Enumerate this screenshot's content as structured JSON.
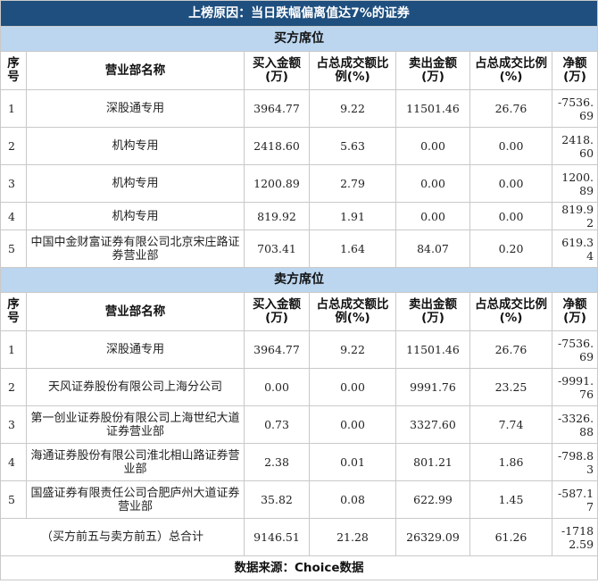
{
  "title": "上榜原因：当日跌幅偏离值达7%的证券",
  "headers": {
    "idx": "序号",
    "name": "营业部名称",
    "buy": "买入金额(万)",
    "buy_ratio": "占总成交额比例(%)",
    "sell": "卖出金额(万)",
    "sell_ratio": "占总成交比例(%)",
    "net": "净额(万)"
  },
  "buy_section": {
    "label": "买方席位",
    "rows": [
      {
        "idx": "1",
        "name": "深股通专用",
        "buy": "3964.77",
        "buy_ratio": "9.22",
        "sell": "11501.46",
        "sell_ratio": "26.76",
        "net": "-7536.69"
      },
      {
        "idx": "2",
        "name": "机构专用",
        "buy": "2418.60",
        "buy_ratio": "5.63",
        "sell": "0.00",
        "sell_ratio": "0.00",
        "net": "2418.60"
      },
      {
        "idx": "3",
        "name": "机构专用",
        "buy": "1200.89",
        "buy_ratio": "2.79",
        "sell": "0.00",
        "sell_ratio": "0.00",
        "net": "1200.89"
      },
      {
        "idx": "4",
        "name": "机构专用",
        "buy": "819.92",
        "buy_ratio": "1.91",
        "sell": "0.00",
        "sell_ratio": "0.00",
        "net": "819.92"
      },
      {
        "idx": "5",
        "name": "中国中金财富证券有限公司北京宋庄路证券营业部",
        "buy": "703.41",
        "buy_ratio": "1.64",
        "sell": "84.07",
        "sell_ratio": "0.20",
        "net": "619.34"
      }
    ]
  },
  "sell_section": {
    "label": "卖方席位",
    "rows": [
      {
        "idx": "1",
        "name": "深股通专用",
        "buy": "3964.77",
        "buy_ratio": "9.22",
        "sell": "11501.46",
        "sell_ratio": "26.76",
        "net": "-7536.69"
      },
      {
        "idx": "2",
        "name": "天风证券股份有限公司上海分公司",
        "buy": "0.00",
        "buy_ratio": "0.00",
        "sell": "9991.76",
        "sell_ratio": "23.25",
        "net": "-9991.76"
      },
      {
        "idx": "3",
        "name": "第一创业证券股份有限公司上海世纪大道证券营业部",
        "buy": "0.73",
        "buy_ratio": "0.00",
        "sell": "3327.60",
        "sell_ratio": "7.74",
        "net": "-3326.88"
      },
      {
        "idx": "4",
        "name": "海通证券股份有限公司淮北相山路证券营业部",
        "buy": "2.38",
        "buy_ratio": "0.01",
        "sell": "801.21",
        "sell_ratio": "1.86",
        "net": "-798.83"
      },
      {
        "idx": "5",
        "name": "国盛证券有限责任公司合肥庐州大道证券营业部",
        "buy": "35.82",
        "buy_ratio": "0.08",
        "sell": "622.99",
        "sell_ratio": "1.45",
        "net": "-587.17"
      }
    ]
  },
  "total": {
    "label": "（买方前五与卖方前五）总合计",
    "buy": "9146.51",
    "buy_ratio": "21.28",
    "sell": "26329.09",
    "sell_ratio": "61.26",
    "net": "-17182.59"
  },
  "source": "数据来源：Choice数据",
  "colors": {
    "title_bg": "#1e4f7f",
    "section_bg": "#bcd6ef",
    "border": "#c9c9c9"
  }
}
